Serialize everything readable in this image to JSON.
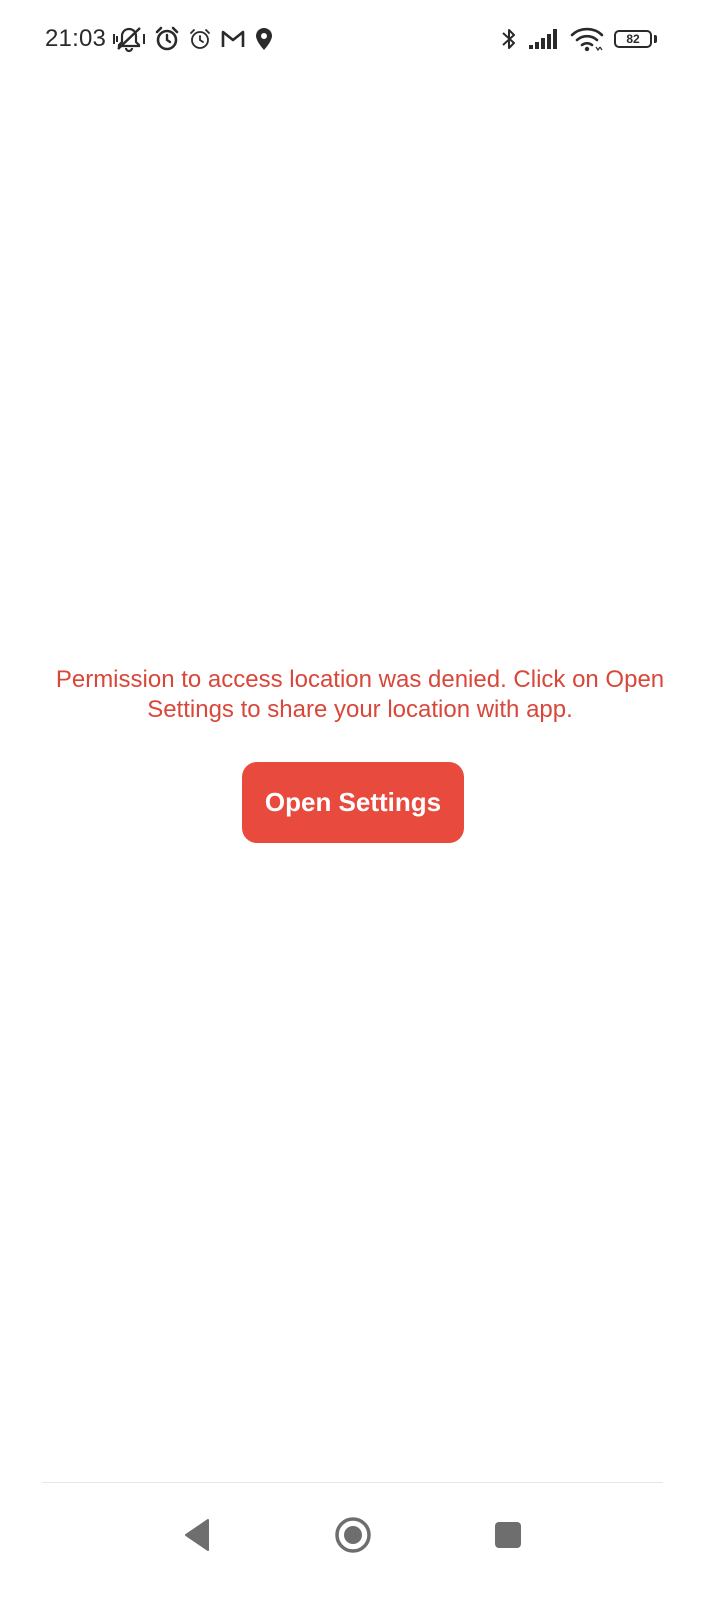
{
  "status_bar": {
    "time": "21:03",
    "left_icons": [
      "vibrate-off-icon",
      "alarm-icon",
      "alarm-outline-icon",
      "gmail-icon",
      "location-pin-icon"
    ],
    "right_icons": [
      "bluetooth-icon",
      "signal-icon",
      "wifi-icon"
    ],
    "battery_level": "82"
  },
  "main": {
    "message": "Permission to access location was denied. Click on Open Settings to share your location with app.",
    "open_settings_label": "Open Settings"
  },
  "navigation_bar": {
    "icons": [
      "back-icon",
      "home-icon",
      "recents-icon"
    ]
  },
  "colors": {
    "accent": "#e84b3d",
    "message_text": "#d9473a",
    "nav_icons": "#6e6e6e"
  }
}
